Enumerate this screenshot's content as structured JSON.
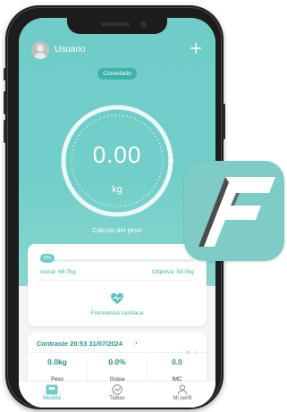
{
  "header": {
    "username": "Usuario",
    "add_icon": "plus-icon"
  },
  "status": {
    "connection": "Conectado"
  },
  "gauge": {
    "value": "0.00",
    "unit": "kg",
    "label": "Cálculo del peso"
  },
  "progress": {
    "percent_label": "0%",
    "percent": 0,
    "initial_label": "Inicial: 66.7kg",
    "goal_label": "Objetiva: 58.0kg"
  },
  "heart_rate": {
    "icon": "heart-pulse-icon",
    "label": "Frecuencia cardiaca"
  },
  "contrast": {
    "title": "Contraste 20:53 31/07/2024",
    "metrics": [
      {
        "value": "0.0kg",
        "label": "Peso"
      },
      {
        "value": "0.0%",
        "label": "Grasa"
      },
      {
        "value": "0.0",
        "label": "IMC"
      }
    ]
  },
  "tabs": [
    {
      "label": "Medida",
      "icon": "scale-icon",
      "active": true
    },
    {
      "label": "Tablas",
      "icon": "chart-icon",
      "active": false
    },
    {
      "label": "Mi perfil",
      "icon": "person-icon",
      "active": false
    }
  ],
  "colors": {
    "accent": "#6fccc6",
    "accent_dark": "#3fb2aa",
    "text_teal": "#2a8f88",
    "app_icon_bg": "#7fcbc6"
  }
}
